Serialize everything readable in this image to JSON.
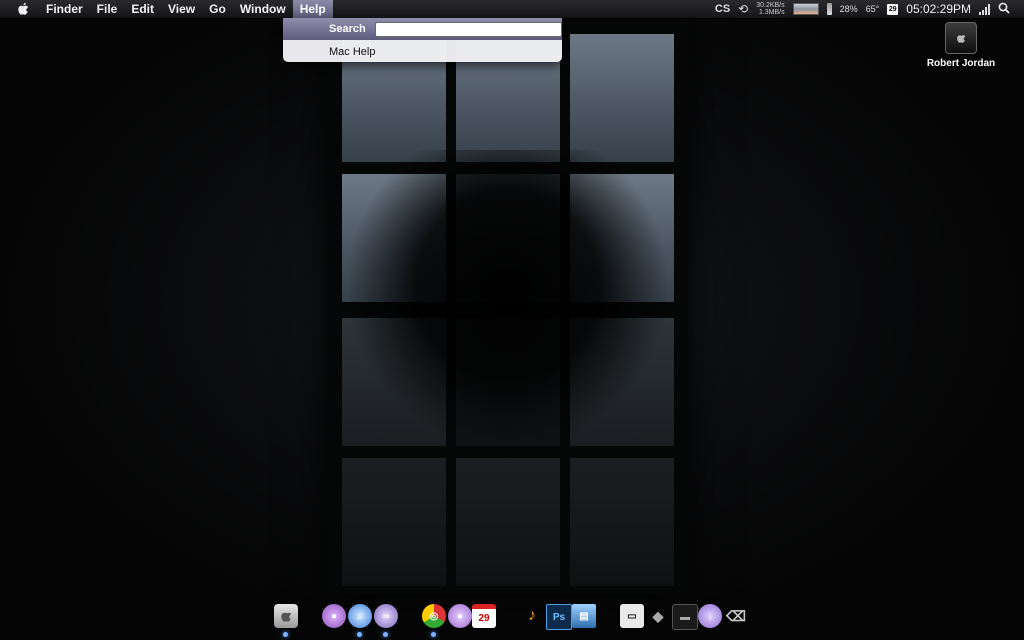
{
  "menubar": {
    "app_name": "Finder",
    "menus": [
      "File",
      "Edit",
      "View",
      "Go",
      "Window",
      "Help"
    ],
    "active_menu": "Help"
  },
  "status": {
    "net_up": "30.2KB/s",
    "net_down": "1.3MB/s",
    "battery_percent": "28%",
    "temperature": "65°",
    "calendar_day": "29",
    "clock": "05:02:29PM"
  },
  "help_menu": {
    "search_label": "Search",
    "search_value": "",
    "items": [
      "Mac Help"
    ]
  },
  "desktop": {
    "icons": [
      {
        "label": "Robert Jordan",
        "icon": "hard-drive-icon"
      }
    ]
  },
  "dock": {
    "items": [
      {
        "name": "finder-icon",
        "glyph": ""
      },
      {
        "name": "purple-orb-icon",
        "glyph": "●"
      },
      {
        "name": "itunes-icon",
        "glyph": "♫"
      },
      {
        "name": "media-icon",
        "glyph": "∞"
      },
      {
        "name": "chrome-icon",
        "glyph": "◎"
      },
      {
        "name": "purple-ball-icon",
        "glyph": "●"
      },
      {
        "name": "calendar-icon",
        "glyph": "29"
      },
      {
        "name": "garageband-icon",
        "glyph": "♪"
      },
      {
        "name": "photoshop-icon",
        "glyph": "Ps"
      },
      {
        "name": "preview-icon",
        "glyph": "▤"
      },
      {
        "name": "device-icon",
        "glyph": "▭"
      },
      {
        "name": "disk-icon",
        "glyph": "◆"
      },
      {
        "name": "drive-icon",
        "glyph": "▬"
      },
      {
        "name": "download-icon",
        "glyph": "↓"
      },
      {
        "name": "trash-icon",
        "glyph": "⌫"
      }
    ]
  },
  "colors": {
    "menu_highlight": "#7c79a0",
    "dock_indicator": "#7fb0ff"
  }
}
